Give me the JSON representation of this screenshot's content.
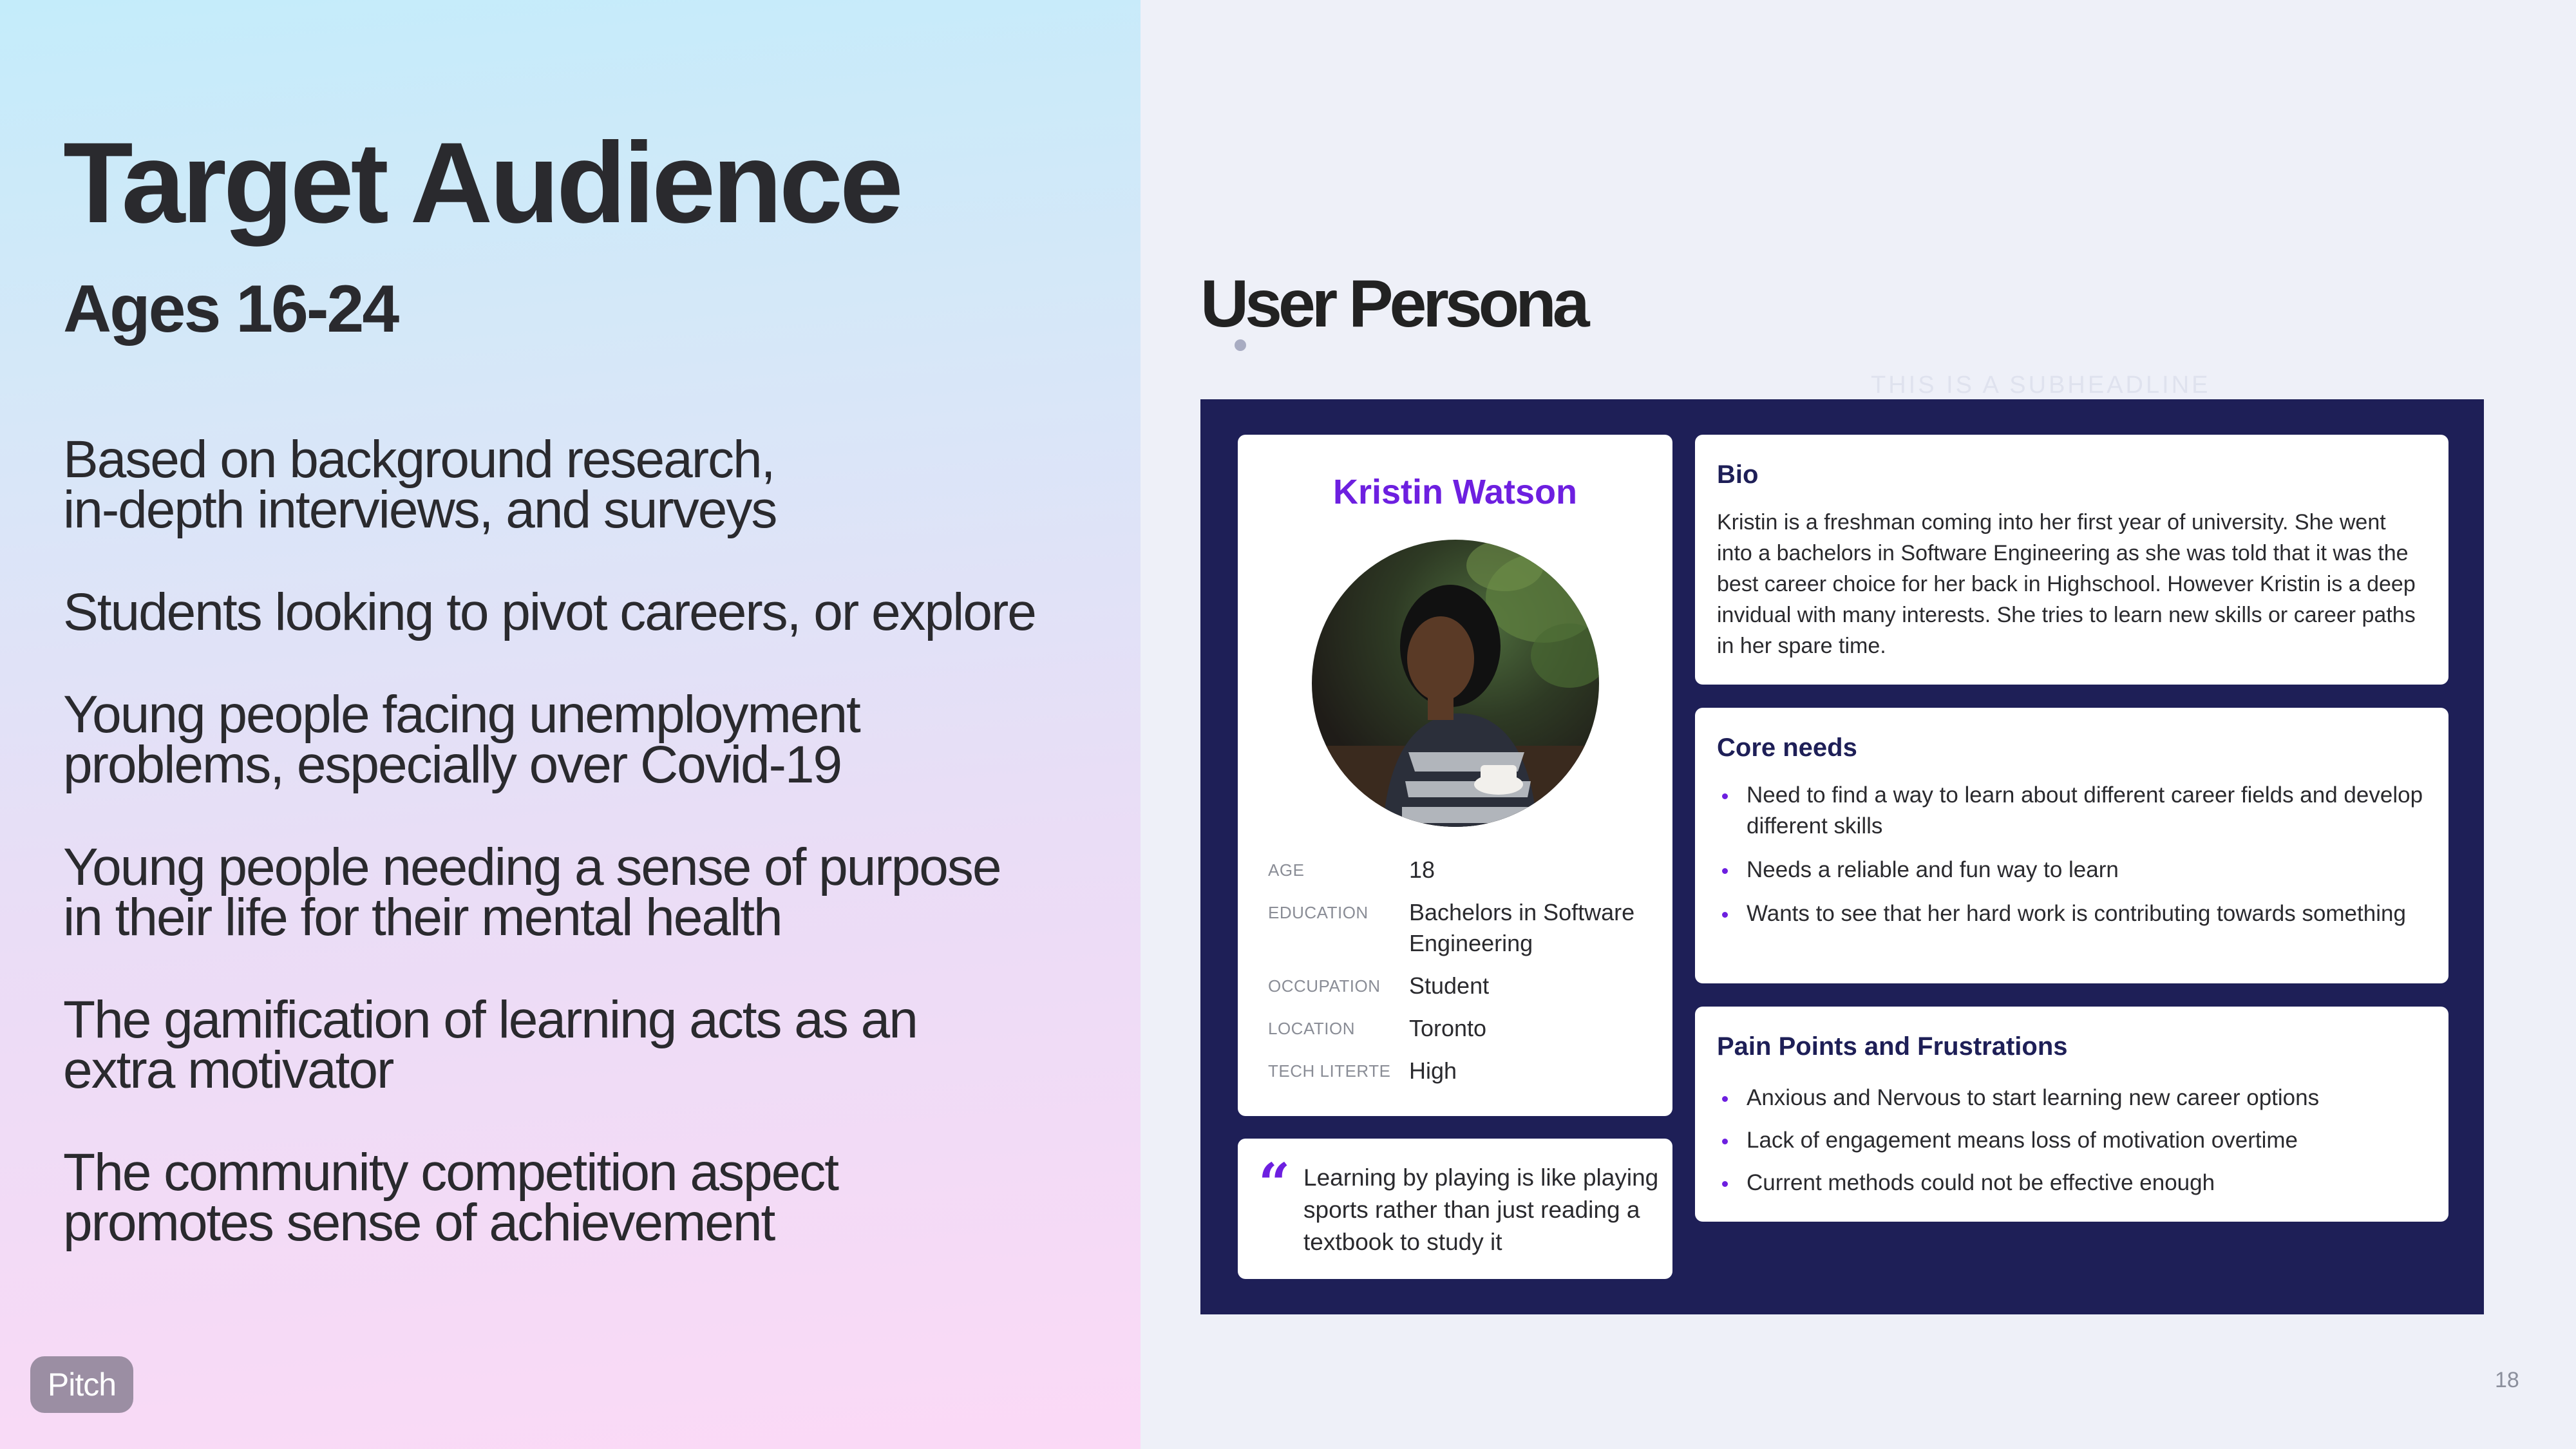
{
  "left": {
    "title": "Target Audience",
    "subtitle": "Ages 16-24",
    "points": [
      {
        "line1": "Based on background research,",
        "line2": "in-depth interviews, and surveys"
      },
      {
        "line1": "Students looking to pivot careers, or explore",
        "line2": ""
      },
      {
        "line1": "Young people facing unemployment",
        "line2": "problems, especially over Covid-19"
      },
      {
        "line1": "Young people needing a sense of purpose",
        "line2": "in their life for their mental health"
      },
      {
        "line1": "The gamification of learning acts as an",
        "line2": "extra motivator"
      },
      {
        "line1": "The community competition aspect",
        "line2": "promotes sense of achievement"
      }
    ],
    "brand": "Pitch"
  },
  "right": {
    "heading": "User Persona",
    "subheadline": "THIS IS A SUBHEADLINE",
    "page_number": "18"
  },
  "persona": {
    "name": "Kristin Watson",
    "attributes": [
      {
        "label": "AGE",
        "value": "18"
      },
      {
        "label": "EDUCATION",
        "value": "Bachelors in Software Engineering"
      },
      {
        "label": "OCCUPATION",
        "value": "Student"
      },
      {
        "label": "LOCATION",
        "value": "Toronto"
      },
      {
        "label": "TECH LITERTE",
        "value": "High"
      }
    ],
    "quote_mark": "“",
    "quote": "Learning by playing is like playing sports rather than just reading a textbook to study it",
    "bio": {
      "title": "Bio",
      "text": "Kristin is a freshman coming into her first year of university. She went into a bachelors in Software Engineering as she was told that it was the best career choice for her back in Highschool. However Kristin is a deep invidual with many interests. She tries to learn new skills or career paths in her spare time."
    },
    "core_needs": {
      "title": "Core needs",
      "items": [
        "Need to find a way to learn about different career fields and develop different skills",
        "Needs a reliable and fun way to learn",
        "Wants to see that her hard work is contributing towards something"
      ]
    },
    "pain_points": {
      "title": "Pain Points and Frustrations",
      "items": [
        "Anxious and Nervous to start learning new career options",
        "Lack of engagement means loss of motivation overtime",
        "Current methods could not be effective enough"
      ]
    }
  },
  "colors": {
    "accent": "#6d1fe0",
    "navy": "#1e1f57",
    "text": "#2a2a2e",
    "badge": "#9b8ea3"
  }
}
